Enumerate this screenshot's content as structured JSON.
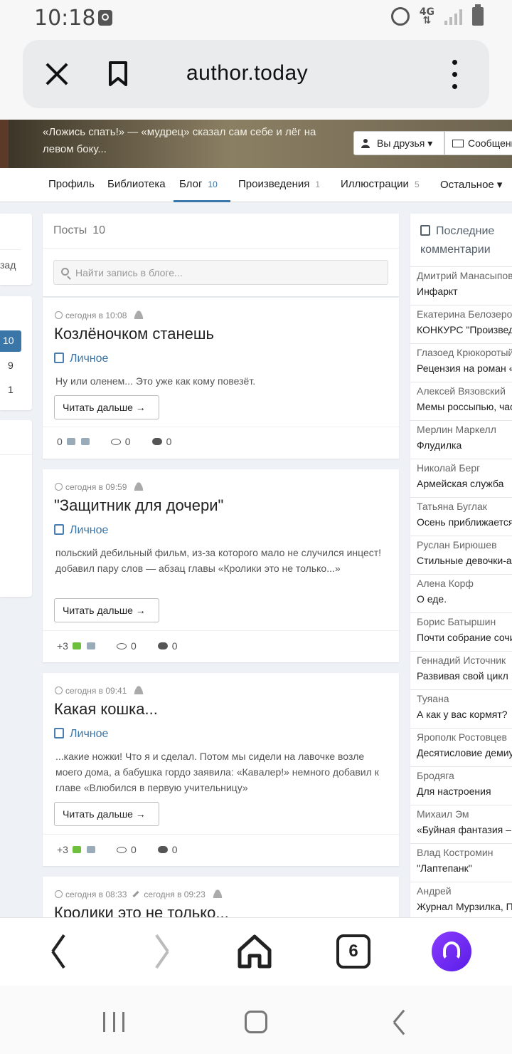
{
  "status_bar": {
    "time": "10:18",
    "network": "4G"
  },
  "browser": {
    "url": "author.today",
    "tabs_count": "6"
  },
  "header": {
    "quote": "«Ложись спать!» — «мудрец» сказал сам себе и лёг на левом боку...",
    "friends_button": "Вы друзья ▾",
    "message_button": "Сообщение"
  },
  "profile_nav": [
    {
      "label": "Профиль",
      "count": ""
    },
    {
      "label": "Библиотека",
      "count": ""
    },
    {
      "label": "Блог",
      "count": "10"
    },
    {
      "label": "Произведения",
      "count": "1"
    },
    {
      "label": "Иллюстрации",
      "count": "5"
    },
    {
      "label": "Остальное ▾",
      "count": ""
    }
  ],
  "left_fragments": {
    "back_text": "зад",
    "pages": [
      "10",
      "9",
      "1"
    ]
  },
  "posts_panel": {
    "title": "Посты",
    "count": "10",
    "search_placeholder": "Найти запись в блоге..."
  },
  "posts": [
    {
      "time": "сегодня в 10:08",
      "title": "Козлёночком станешь",
      "category": "Личное",
      "excerpt": "Ну или оленем... Это уже как кому повезёт.",
      "read_more": "Читать дальше →",
      "rating": "0",
      "views": "0",
      "comments": "0"
    },
    {
      "time": "сегодня в 09:59",
      "title": "\"Защитник для дочери\"",
      "category": "Личное",
      "excerpt": "польский дебильный фильм, из-за которого мало не случился инцест! добавил пару слов — абзац главы «Кролики это не только...»",
      "read_more": "Читать дальше →",
      "rating": "+3",
      "views": "0",
      "comments": "0"
    },
    {
      "time": "сегодня в 09:41",
      "title": "Какая кошка...",
      "category": "Личное",
      "excerpt": "...какие ножки! Что я и сделал. Потом мы сидели на лавочке возле моего дома, а бабушка гордо заявила: «Кавалер!» немного добавил к главе «Влюбился в первую учительницу»",
      "read_more": "Читать дальше →",
      "rating": "+3",
      "views": "0",
      "comments": "0"
    },
    {
      "time": "сегодня в 08:33",
      "edited": "сегодня в 09:23",
      "title": "Кролики это не только..."
    }
  ],
  "comments_sidebar": {
    "title": "Последние комментарии",
    "items": [
      {
        "author": "Дмитрий Манасыпов",
        "text": "Инфаркт"
      },
      {
        "author": "Екатерина Белозерова",
        "text": "КОНКУРС \"Произведение"
      },
      {
        "author": "Глазоед Крюкоротый",
        "text": "Рецензия на роман «"
      },
      {
        "author": "Алексей Вязовский",
        "text": "Мемы россыпью, часть"
      },
      {
        "author": "Мерлин Маркелл",
        "text": "Флудилка"
      },
      {
        "author": "Николай Берг",
        "text": "Армейская служба"
      },
      {
        "author": "Татьяна Буглак",
        "text": "Осень приближается"
      },
      {
        "author": "Руслан Бирюшев",
        "text": "Стильные девочки-а"
      },
      {
        "author": "Алена Корф",
        "text": "О еде."
      },
      {
        "author": "Борис Батыршин",
        "text": "Почти собрание сочин"
      },
      {
        "author": "Геннадий Источник",
        "text": "Развивая свой цикл"
      },
      {
        "author": "Туяана",
        "text": "А как у вас кормят?"
      },
      {
        "author": "Ярополк Ростовцев",
        "text": "Десятисловие демиу"
      },
      {
        "author": "Бродяга",
        "text": "Для настроения"
      },
      {
        "author": "Михаил Эм",
        "text": "«Буйная фантазия –"
      },
      {
        "author": "Влад Костромин",
        "text": "\"Лаптепанк\""
      },
      {
        "author": "Андрей",
        "text": "Журнал Мурзилка, П"
      }
    ]
  }
}
